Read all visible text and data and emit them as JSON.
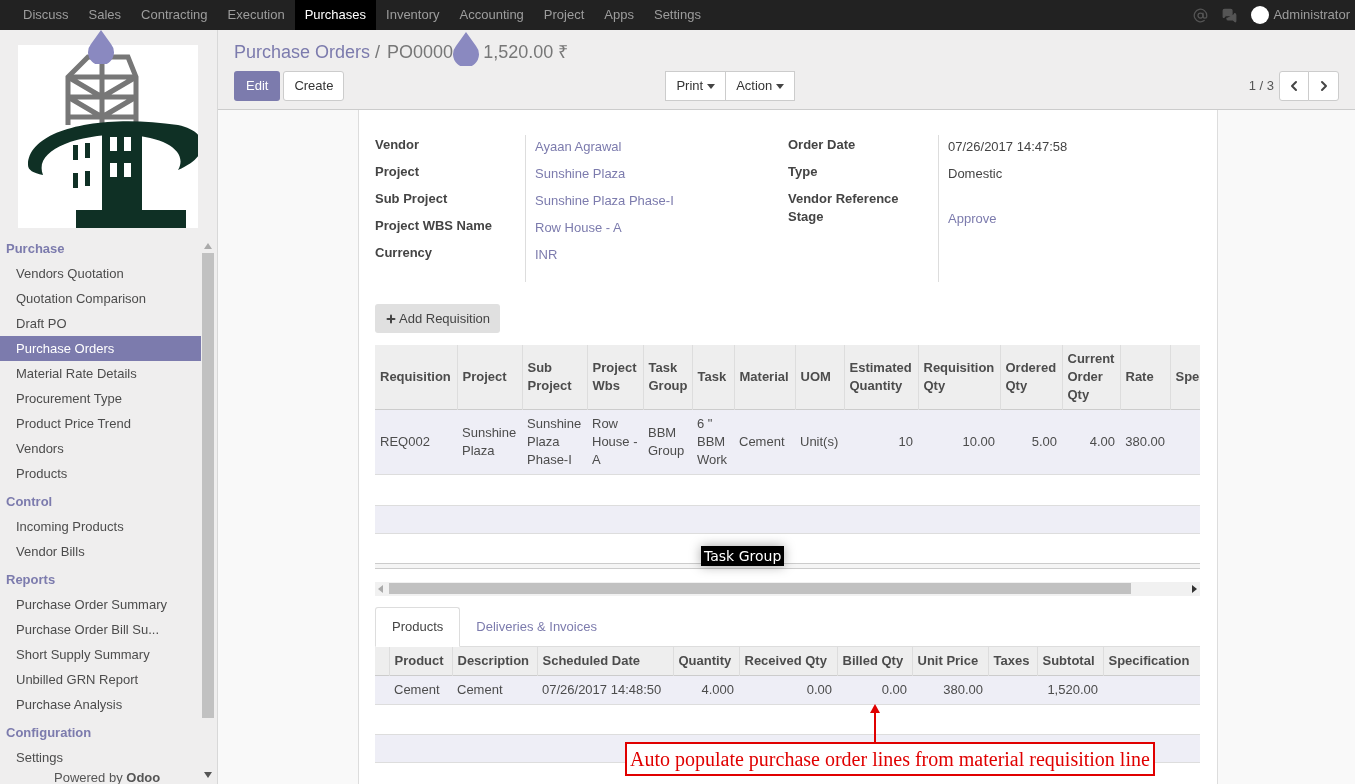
{
  "top_menu": [
    {
      "label": "Discuss",
      "selected": false
    },
    {
      "label": "Sales",
      "selected": false
    },
    {
      "label": "Contracting",
      "selected": false
    },
    {
      "label": "Execution",
      "selected": false
    },
    {
      "label": "Purchases",
      "selected": true
    },
    {
      "label": "Inventory",
      "selected": false
    },
    {
      "label": "Accounting",
      "selected": false
    },
    {
      "label": "Project",
      "selected": false
    },
    {
      "label": "Apps",
      "selected": false
    },
    {
      "label": "Settings",
      "selected": false
    }
  ],
  "user": {
    "name": "Administrator"
  },
  "sidebar": {
    "sections": [
      {
        "title": "Purchase",
        "items": [
          {
            "label": "Vendors Quotation",
            "selected": false
          },
          {
            "label": "Quotation Comparison",
            "selected": false
          },
          {
            "label": "Draft PO",
            "selected": false
          },
          {
            "label": "Purchase Orders",
            "selected": true
          },
          {
            "label": "Material Rate Details",
            "selected": false
          },
          {
            "label": "Procurement Type",
            "selected": false
          },
          {
            "label": "Product Price Trend",
            "selected": false
          },
          {
            "label": "Vendors",
            "selected": false
          },
          {
            "label": "Products",
            "selected": false
          }
        ]
      },
      {
        "title": "Control",
        "items": [
          {
            "label": "Incoming Products",
            "selected": false
          },
          {
            "label": "Vendor Bills",
            "selected": false
          }
        ]
      },
      {
        "title": "Reports",
        "items": [
          {
            "label": "Purchase Order Summary",
            "selected": false
          },
          {
            "label": "Purchase Order Bill Su...",
            "selected": false
          },
          {
            "label": "Short Supply Summary",
            "selected": false
          },
          {
            "label": "Unbilled GRN Report",
            "selected": false
          },
          {
            "label": "Purchase Analysis",
            "selected": false
          }
        ]
      },
      {
        "title": "Configuration",
        "items": [
          {
            "label": "Settings",
            "selected": false
          }
        ]
      }
    ],
    "footer_prefix": "Powered by",
    "footer_brand": "Odoo"
  },
  "breadcrumb": {
    "parent": "Purchase Orders",
    "separator": "/",
    "current_start": "PO0000",
    "current_end": "1,520.00 ₹"
  },
  "buttons": {
    "edit": "Edit",
    "create": "Create"
  },
  "dropdowns": [
    "Print",
    "Action"
  ],
  "pager": "1 / 3",
  "form": {
    "left": [
      {
        "label": "Vendor",
        "value": "Ayaan Agrawal",
        "kind": "link"
      },
      {
        "label": "Project",
        "value": "Sunshine Plaza",
        "kind": "link"
      },
      {
        "label": "Sub Project",
        "value": "Sunshine Plaza Phase-I",
        "kind": "link"
      },
      {
        "label": "Project WBS Name",
        "value": "Row House - A",
        "kind": "link"
      },
      {
        "label": "Currency",
        "value": "INR",
        "kind": "link"
      }
    ],
    "right": [
      {
        "label": "Order Date",
        "value": "07/26/2017 14:47:58",
        "kind": "text"
      },
      {
        "label": "Type",
        "value": "Domestic",
        "kind": "text"
      },
      {
        "label": "Vendor Reference"
      },
      {
        "label": "Stage",
        "value": "Approve",
        "kind": "link"
      }
    ]
  },
  "add_requisition": "Add Requisition",
  "requisition_table": {
    "columns": [
      {
        "label": "Requisition",
        "kind": "text"
      },
      {
        "label": "Project",
        "kind": "text"
      },
      {
        "label": "Sub Project",
        "kind": "text"
      },
      {
        "label": "Project Wbs",
        "kind": "text"
      },
      {
        "label": "Task Group",
        "kind": "text"
      },
      {
        "label": "Task",
        "kind": "text"
      },
      {
        "label": "Material",
        "kind": "text"
      },
      {
        "label": "UOM",
        "kind": "text"
      },
      {
        "label": "Estimated Quantity",
        "kind": "number"
      },
      {
        "label": "Requisition Qty",
        "kind": "number"
      },
      {
        "label": "Ordered Qty",
        "kind": "number"
      },
      {
        "label": "Current Order Qty",
        "kind": "number"
      },
      {
        "label": "Rate",
        "kind": "number"
      },
      {
        "label": "Spe",
        "kind": "text"
      }
    ],
    "rows": [
      [
        "REQ002",
        "Sunshine Plaza",
        "Sunshine Plaza Phase-I",
        "Row House - A",
        "BBM Group",
        "6 \" BBM Work",
        "Cement",
        "Unit(s)",
        "10",
        "10.00",
        "5.00",
        "4.00",
        "380.00",
        ""
      ]
    ]
  },
  "tooltip": "Task Group",
  "tabs": [
    {
      "label": "Products",
      "selected": true
    },
    {
      "label": "Deliveries & Invoices",
      "selected": false
    }
  ],
  "products_table": {
    "columns": [
      {
        "label": "Product",
        "kind": "text"
      },
      {
        "label": "Description",
        "kind": "text"
      },
      {
        "label": "Scheduled Date",
        "kind": "text"
      },
      {
        "label": "Quantity",
        "kind": "number"
      },
      {
        "label": "Received Qty",
        "kind": "number"
      },
      {
        "label": "Billed Qty",
        "kind": "number"
      },
      {
        "label": "Unit Price",
        "kind": "number"
      },
      {
        "label": "Taxes",
        "kind": "text"
      },
      {
        "label": "Subtotal",
        "kind": "number"
      },
      {
        "label": "Specification",
        "kind": "text"
      }
    ],
    "rows": [
      [
        "Cement",
        "Cement",
        "07/26/2017 14:48:50",
        "4.000",
        "0.00",
        "0.00",
        "380.00",
        "",
        "1,520.00",
        ""
      ]
    ]
  },
  "annotation": "Auto populate purchase order lines from material requisition line"
}
